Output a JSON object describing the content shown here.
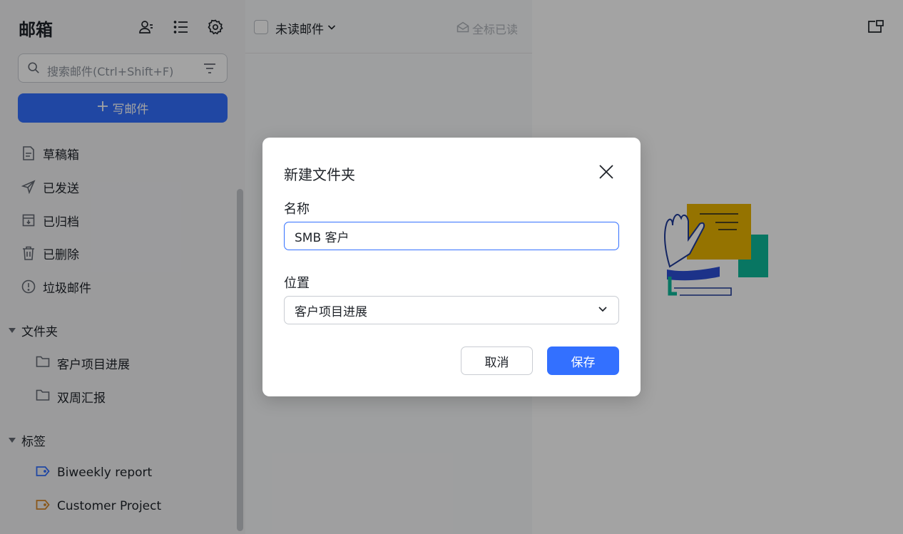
{
  "sidebar": {
    "title": "邮箱",
    "tools": [
      {
        "icon": "contacts-icon"
      },
      {
        "icon": "list-view-icon"
      },
      {
        "icon": "settings-icon"
      }
    ],
    "search": {
      "placeholder": "搜索邮件(Ctrl+Shift+F)",
      "filter_icon": "filter-icon"
    },
    "compose_label": "写邮件",
    "nav": [
      {
        "label": "草稿箱",
        "icon": "draft-icon"
      },
      {
        "label": "已发送",
        "icon": "send-icon"
      },
      {
        "label": "已归档",
        "icon": "archive-icon"
      },
      {
        "label": "已删除",
        "icon": "trash-icon"
      },
      {
        "label": "垃圾邮件",
        "icon": "spam-icon"
      }
    ],
    "folders": {
      "title": "文件夹",
      "items": [
        {
          "label": "客户项目进展",
          "icon": "folder-icon"
        },
        {
          "label": "双周汇报",
          "icon": "folder-icon"
        }
      ]
    },
    "labels": {
      "title": "标签",
      "items": [
        {
          "label": "Biweekly report",
          "icon": "tag-icon",
          "color": "#3370ff"
        },
        {
          "label": "Customer Project",
          "icon": "tag-icon",
          "color": "#d7882a"
        }
      ]
    }
  },
  "list": {
    "filter_label": "未读邮件",
    "mark_all_label": "全标已读"
  },
  "modal": {
    "title": "新建文件夹",
    "name_label": "名称",
    "name_value": "SMB 客户",
    "location_label": "位置",
    "location_value": "客户项目进展",
    "cancel_label": "取消",
    "save_label": "保存"
  },
  "colors": {
    "accent": "#3370ff",
    "illustration_yellow": "#e9b400",
    "illustration_teal": "#0db99a",
    "illustration_blue": "#2d4fd6"
  }
}
